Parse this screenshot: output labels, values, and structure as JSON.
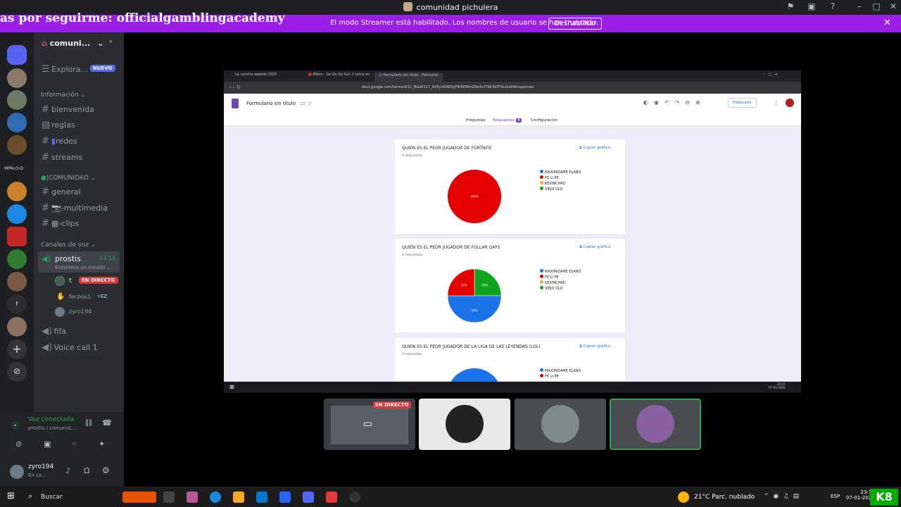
{
  "window": {
    "title": "comunidad pichulera"
  },
  "stream_overlay": {
    "text": "as por seguirme: officialgamblingacademy"
  },
  "streamer_banner": {
    "message": "El modo Streamer está habilitado. Los nombres de usuario se han truncado.",
    "button": "Deshabilitar"
  },
  "rail": {
    "server_label": "MPÀn3-D"
  },
  "sidebar": {
    "server_name": "comuni...",
    "explore": "Explora...",
    "new_badge": "NUEVO",
    "info_category": "Información",
    "info_channels": [
      "bienvenida",
      "reglas",
      "redes",
      "streams"
    ],
    "community_category": "COMUNIDAD",
    "community_channels": [
      "general",
      "-multimedia",
      "-clips"
    ],
    "voice_category": "Canales de voz",
    "voice_channel": "prostis",
    "voice_time": "13:14",
    "voice_status": "Establece un estado ...",
    "members": [
      {
        "name": "f.",
        "badge": "EN DIRECTO"
      },
      {
        "name": "fecbos1",
        "badge": "EZ"
      },
      {
        "name": "zyro194"
      }
    ],
    "other_voice": [
      "fifa",
      "Voice call 1"
    ]
  },
  "voice_panel": {
    "title": "Voz conectada",
    "sub": "prostis / comunid...",
    "user": "zyro194",
    "user_status": "En ca..."
  },
  "browser": {
    "tabs": [
      "La concha awards 2025",
      "89ers - Go Go Go Go! // Letra en",
      "Formulario sin título - Formulari"
    ],
    "url": "docs.google.com/forms/d/1C_BGdE117_9V0yrGD9OyF9OIHMmO6s4uY7W-5kPYXc/edit#responses"
  },
  "forms": {
    "title": "Formulario sin título",
    "tabs": [
      "Preguntas",
      "Respuestas",
      "Configuración"
    ],
    "responses_count": "4",
    "publish": "Publicado",
    "copy_label": "Copiar gráfico",
    "legend": [
      "MAXIMIZAME ELANO",
      "FE LI PE",
      "KEVINCHAD",
      "VIEJO OLO"
    ],
    "questions": [
      {
        "title": "QUIEN ES EL PEOR JUGADOR DE FORTNITE",
        "subtitle": "4 respuestas",
        "slices": [
          {
            "label": "100%",
            "value": 100,
            "color": "#e50000"
          }
        ]
      },
      {
        "title": "QUIEN ES EL PEOR JUGADOR DE FOLLAR GAYS",
        "subtitle": "4 respuestas",
        "slices": [
          {
            "label": "50%",
            "value": 50,
            "color": "#1a73e8"
          },
          {
            "label": "25%",
            "value": 25,
            "color": "#e50000"
          },
          {
            "label": "25%",
            "value": 25,
            "color": "#0fa51e"
          }
        ]
      },
      {
        "title": "QUIEN ES EL PEOR JUGADOR DE LA LIGA DE LAS LEYENDAS (LOL)",
        "subtitle": "4 respuestas"
      }
    ],
    "legend_colors": [
      "#1a73e8",
      "#e50000",
      "#f9a825",
      "#0fa51e"
    ]
  },
  "chart_data": [
    {
      "type": "pie",
      "title": "QUIEN ES EL PEOR JUGADOR DE FORTNITE",
      "categories": [
        "MAXIMIZAME ELANO",
        "FE LI PE",
        "KEVINCHAD",
        "VIEJO OLO"
      ],
      "values": [
        0,
        100,
        0,
        0
      ],
      "legend": "right"
    },
    {
      "type": "pie",
      "title": "QUIEN ES EL PEOR JUGADOR DE FOLLAR GAYS",
      "categories": [
        "MAXIMIZAME ELANO",
        "FE LI PE",
        "KEVINCHAD",
        "VIEJO OLO"
      ],
      "values": [
        50,
        25,
        0,
        25
      ],
      "legend": "right"
    }
  ],
  "tiles": {
    "live_badge": "EN DIRECTO"
  },
  "taskbar": {
    "search": "Buscar",
    "weather": "21°C  Parc. nublado",
    "lang": "ESP",
    "time": "23:15",
    "date": "07-01-2026",
    "inner_time": "23:15",
    "inner_date": "07-01-2026"
  }
}
